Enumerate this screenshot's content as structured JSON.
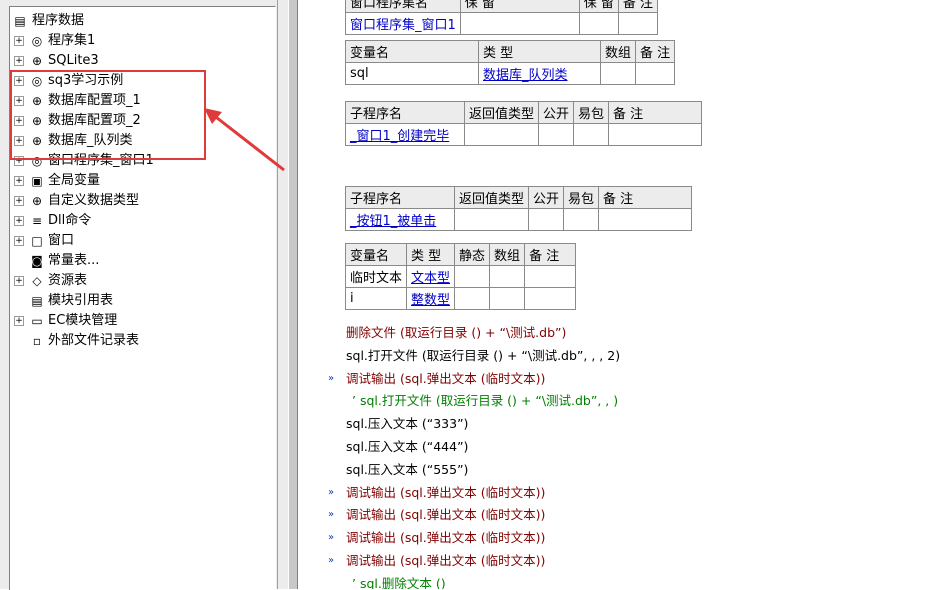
{
  "tree": {
    "root": "程序数据",
    "items": [
      {
        "label": "程序集1",
        "icon": "assembly-icon",
        "glyph": "◎"
      },
      {
        "label": "SQLite3",
        "icon": "module-icon",
        "glyph": "⊕"
      },
      {
        "label": "sq3学习示例",
        "icon": "assembly-icon",
        "glyph": "◎"
      },
      {
        "label": "数据库配置项_1",
        "icon": "module-icon",
        "glyph": "⊕"
      },
      {
        "label": "数据库配置项_2",
        "icon": "module-icon",
        "glyph": "⊕"
      },
      {
        "label": "数据库_队列类",
        "icon": "module-icon",
        "glyph": "⊕"
      },
      {
        "label": "窗口程序集_窗口1",
        "icon": "assembly-icon",
        "glyph": "◎"
      },
      {
        "label": "全局变量",
        "icon": "database-icon",
        "glyph": "▣"
      },
      {
        "label": "自定义数据类型",
        "icon": "module-icon",
        "glyph": "⊕"
      },
      {
        "label": "Dll命令",
        "icon": "dll-icon",
        "glyph": "≡"
      },
      {
        "label": "窗口",
        "icon": "window-icon",
        "glyph": "□"
      },
      {
        "label": "常量表...",
        "icon": "constant-icon",
        "glyph": "◙"
      },
      {
        "label": "资源表",
        "icon": "resource-icon",
        "glyph": "◇"
      },
      {
        "label": "模块引用表",
        "icon": "module-ref-icon",
        "glyph": "▤"
      },
      {
        "label": "EC模块管理",
        "icon": "folder-icon",
        "glyph": "▭"
      },
      {
        "label": "外部文件记录表",
        "icon": "file-icon",
        "glyph": "▫"
      }
    ]
  },
  "code": {
    "assembly_table": {
      "headers": [
        "窗口程序集名",
        "保 留",
        "保 留",
        "备 注"
      ],
      "row": [
        "窗口程序集_窗口1",
        "",
        "",
        ""
      ]
    },
    "var_table": {
      "headers": [
        "变量名",
        "类 型",
        "数组",
        "备 注"
      ],
      "row": [
        "sql",
        "数据库_队列类",
        "",
        ""
      ]
    },
    "sub1_table": {
      "headers": [
        "子程序名",
        "返回值类型",
        "公开",
        "易包",
        "备 注"
      ],
      "row": [
        "_窗口1_创建完毕",
        "",
        "",
        "",
        ""
      ]
    },
    "sub2_table": {
      "headers": [
        "子程序名",
        "返回值类型",
        "公开",
        "易包",
        "备 注"
      ],
      "row": [
        "_按钮1_被单击",
        "",
        "",
        "",
        ""
      ]
    },
    "local_table": {
      "headers": [
        "变量名",
        "类 型",
        "静态",
        "数组",
        "备 注"
      ],
      "rows": [
        [
          "临时文本",
          "文本型",
          "",
          "",
          ""
        ],
        [
          "i",
          "整数型",
          "",
          "",
          ""
        ]
      ]
    },
    "lines": [
      "删除文件 (取运行目录 () + “\\测试.db”)",
      "sql.打开文件 (取运行目录 () + “\\测试.db”, , , 2)",
      "调试输出 (sql.弹出文本 (临时文本))",
      "’ sql.打开文件 (取运行目录 () + “\\测试.db”, , )",
      "sql.压入文本 (“333”)",
      "sql.压入文本 (“444”)",
      "sql.压入文本 (“555”)",
      "调试输出 (sql.弹出文本 (临时文本))",
      "调试输出 (sql.弹出文本 (临时文本))",
      "调试输出 (sql.弹出文本 (临时文本))",
      "调试输出 (sql.弹出文本 (临时文本))",
      "’ sql.删除文本 ()"
    ],
    "line_markers": [
      "",
      "",
      "»",
      "",
      "",
      "",
      "",
      "»",
      "»",
      "»",
      "»",
      ""
    ],
    "line_colors": [
      "#800000",
      "#000000",
      "#800000",
      "#008000",
      "#000000",
      "#000000",
      "#000000",
      "#800000",
      "#800000",
      "#800000",
      "#800000",
      "#008000"
    ]
  },
  "colors": {
    "highlight": "#e03a3a",
    "type_link": "#0000c8",
    "comment": "#008000"
  }
}
